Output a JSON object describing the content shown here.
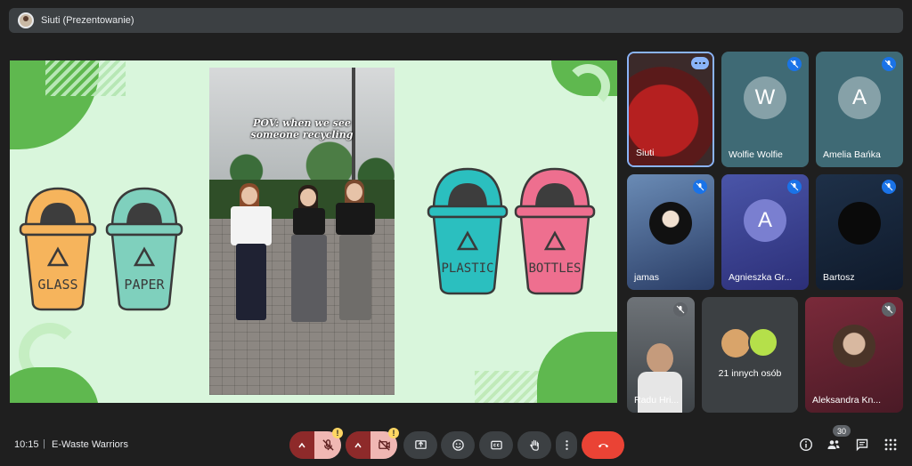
{
  "presenter": {
    "label": "Siuti (Prezentowanie)"
  },
  "slide": {
    "caption_line1": "POV: when we see",
    "caption_line2": "someone recycling",
    "bins": [
      {
        "label": "GLASS",
        "color": "#f6b45c"
      },
      {
        "label": "PAPER",
        "color": "#7fd0bd"
      },
      {
        "label": "PLASTIC",
        "color": "#2bbfbf"
      },
      {
        "label": "BOTTLES",
        "color": "#ee6f8f"
      }
    ]
  },
  "participants": [
    {
      "name": "Siuti",
      "kind": "video",
      "active": true
    },
    {
      "name": "Wolfie Wolfie",
      "initial": "W",
      "muted": true
    },
    {
      "name": "Amelia Bańka",
      "initial": "A",
      "muted": true
    },
    {
      "name": "jamas",
      "kind": "photo",
      "muted": true
    },
    {
      "name": "Agnieszka Gr...",
      "initial": "A",
      "muted": true
    },
    {
      "name": "Bartosz",
      "kind": "photo",
      "muted": true
    },
    {
      "name": "Radu Hri...",
      "kind": "video",
      "muted": true
    },
    {
      "name": "21 innych osób",
      "kind": "group"
    },
    {
      "name": "Aleksandra Kn...",
      "kind": "photo",
      "muted": true
    }
  ],
  "bottom": {
    "time": "10:15",
    "separator": "|",
    "meeting_title": "E-Waste Warriors",
    "people_count": "30",
    "warn_mark": "!"
  },
  "colors": {
    "accent": "#1a73e8",
    "end_call": "#ea4335",
    "warn": "#fdd663"
  }
}
